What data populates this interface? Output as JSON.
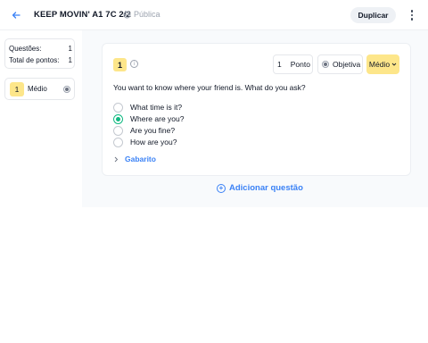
{
  "header": {
    "title": "KEEP MOVIN' A1 7C 2/2",
    "visibility": "Pública",
    "duplicate_label": "Duplicar"
  },
  "summary": {
    "questions_label": "Questões:",
    "questions_value": "1",
    "points_label": "Total de pontos:",
    "points_value": "1"
  },
  "question_list": [
    {
      "number": "1",
      "difficulty": "Médio"
    }
  ],
  "question": {
    "number": "1",
    "points_value": "1",
    "points_unit": "Ponto",
    "type_label": "Objetiva",
    "difficulty": "Médio",
    "prompt": "You want to know where your friend is. What do you ask?",
    "options": [
      {
        "text": "What time is it?",
        "selected": false
      },
      {
        "text": "Where are you?",
        "selected": true
      },
      {
        "text": "Are you fine?",
        "selected": false
      },
      {
        "text": "How are you?",
        "selected": false
      }
    ],
    "answer_key_label": "Gabarito"
  },
  "add_question_label": "Adicionar questão",
  "colors": {
    "accent": "#3b82f6",
    "correct": "#10b981",
    "difficulty_badge": "#fde68a"
  }
}
